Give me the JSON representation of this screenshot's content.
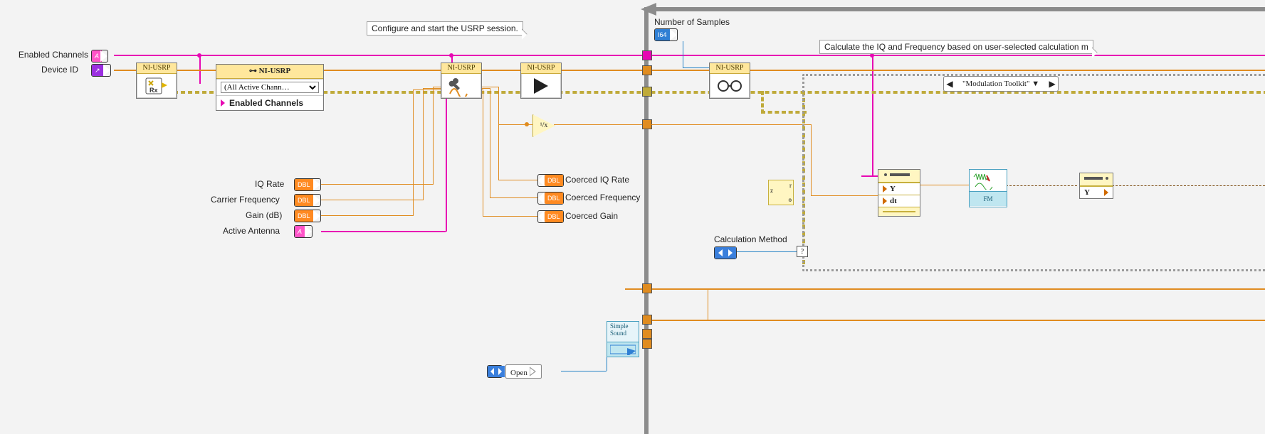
{
  "comments": {
    "configure": "Configure and start the USRP session.",
    "calc": "Calculate the IQ and Frequency based on user-selected calculation m"
  },
  "inputs": {
    "enabled_channels": "Enabled Channels",
    "device_id": "Device ID",
    "iq_rate": "IQ Rate",
    "carrier_freq": "Carrier Frequency",
    "gain_db": "Gain (dB)",
    "active_antenna": "Active Antenna",
    "number_of_samples": "Number of Samples",
    "calc_method": "Calculation Method",
    "open": "Open"
  },
  "indicators": {
    "coerced_iq_rate": "Coerced IQ Rate",
    "coerced_freq": "Coerced Frequency",
    "coerced_gain": "Coerced Gain"
  },
  "term_text": {
    "dbl": "DBL",
    "i64": "I64",
    "str": "A",
    "ref": "↗",
    "reciprocal": "¹/x"
  },
  "usrp": {
    "header": "NI-USRP",
    "prop_header": "⊶  NI-USRP",
    "prop_dropdown": "(All Active Chann…",
    "prop_row": "Enabled Channels"
  },
  "polar": {
    "z": "z",
    "r": "r",
    "t": "ɵ"
  },
  "bundle": {
    "y": "Y",
    "dt": "dt"
  },
  "unbundle2": {
    "y": "Y"
  },
  "fm": {
    "label": "FM"
  },
  "case_selector": "\"Modulation Toolkit\"  ▼",
  "sound": {
    "line1": "Simple",
    "line2": "Sound"
  }
}
